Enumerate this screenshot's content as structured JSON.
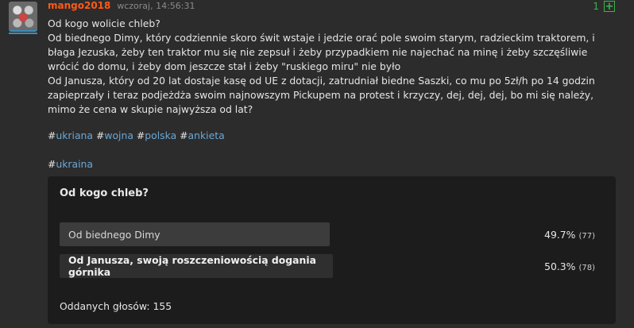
{
  "post": {
    "username": "mango2018",
    "date": "wczoraj, 14:56:31",
    "vote_count": "1",
    "plus_label": "+",
    "lines": [
      "Od kogo wolicie chleb?",
      "Od biednego Dimy, który codziennie skoro świt wstaje i jedzie orać pole swoim starym, radzieckim traktorem, i błaga Jezuska, żeby ten traktor mu się nie zepsuł i żeby przypadkiem nie najechać na minę i żeby szczęśliwie wrócić do domu, i żeby dom jeszcze stał i żeby \"ruskiego miru\" nie było",
      "Od Janusza, który od 20 lat dostaje kasę od UE z dotacji, zatrudniał biedne Saszki, co mu po 5zł/h po 14 godzin zapieprzały i teraz podjeżdża swoim najnowszym Pickupem na protest i krzyczy, dej, dej, dej, bo mi się należy, mimo że cena w skupie najwyższa od lat?"
    ],
    "tags_line1": [
      {
        "hash": "#",
        "name": "ukriana"
      },
      {
        "hash": "#",
        "name": "wojna"
      },
      {
        "hash": "#",
        "name": "polska"
      },
      {
        "hash": "#",
        "name": "ankieta"
      }
    ],
    "tags_line2": [
      {
        "hash": "#",
        "name": "ukraina"
      }
    ]
  },
  "poll": {
    "title": "Od kogo chleb?",
    "options": [
      {
        "label": "Od biednego Dimy",
        "percent": "49.7%",
        "count": "(77)"
      },
      {
        "label": "Od Janusza, swoją roszczeniowością dogania górnika",
        "percent": "50.3%",
        "count": "(78)"
      }
    ],
    "total": "Oddanych głosów: 155"
  },
  "colors": {
    "username": "#ff5917",
    "tag": "#6aa8d6",
    "vote": "#3bb34d",
    "background": "#2c2c2c",
    "poll_background": "#1c1c1c"
  }
}
